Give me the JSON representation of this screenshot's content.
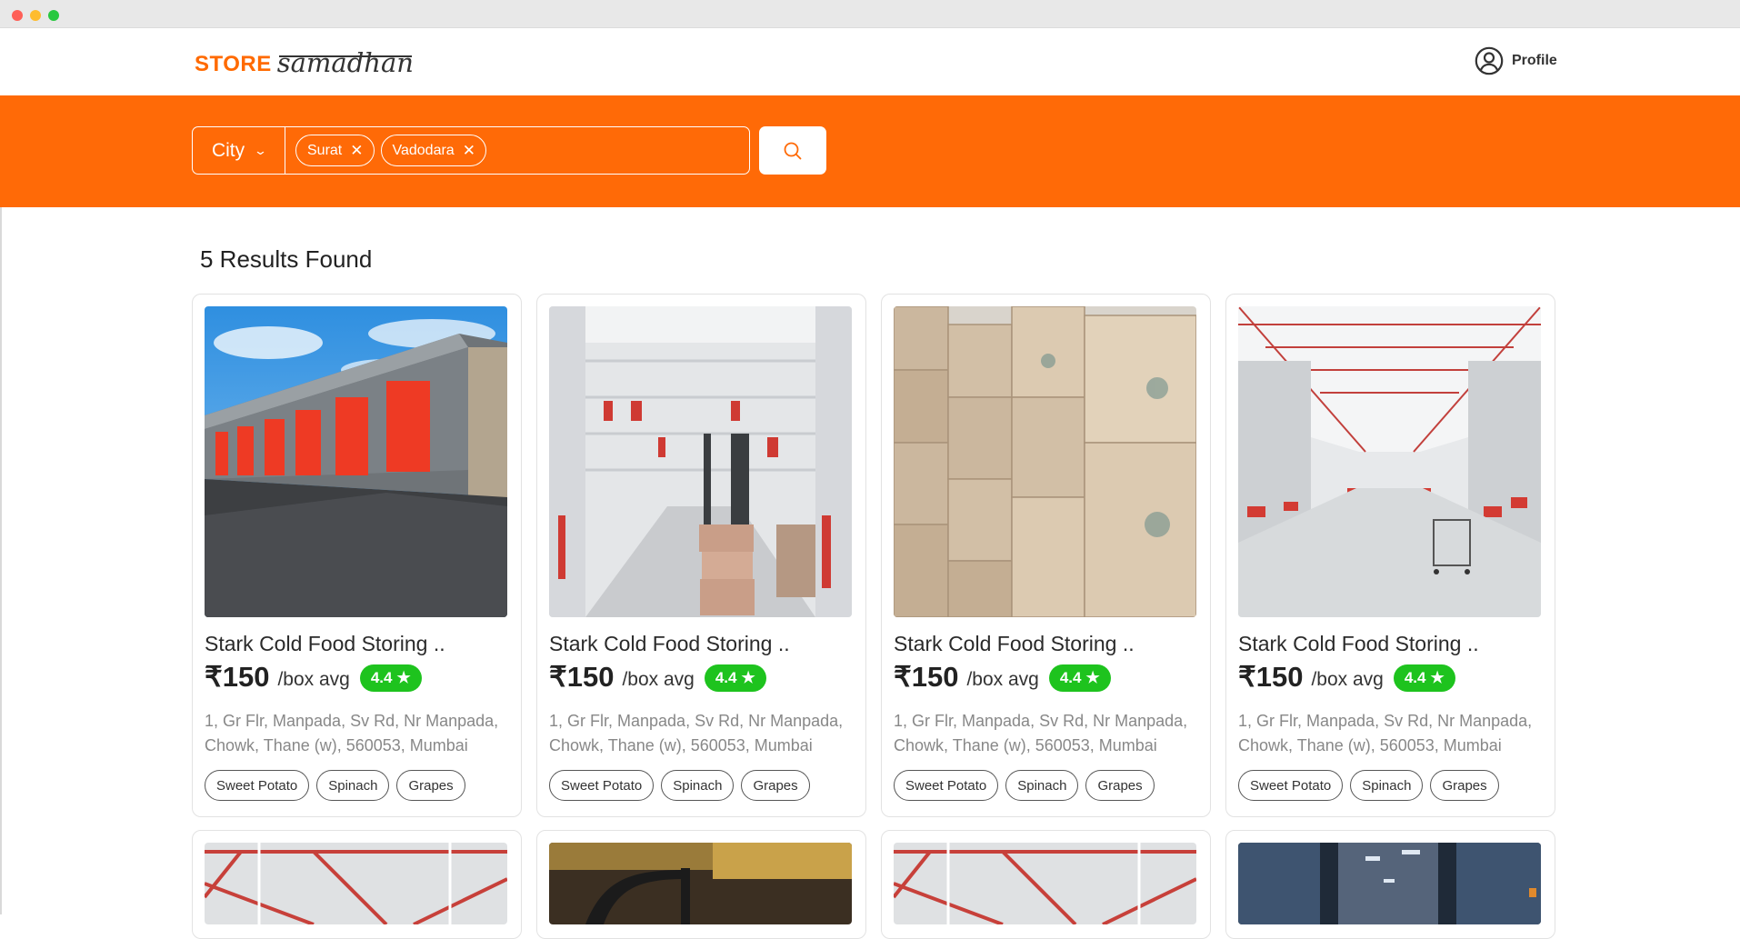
{
  "window": {
    "controls": [
      "close",
      "minimize",
      "maximize"
    ]
  },
  "header": {
    "logo_store": "STORE",
    "logo_samadhan": "samadhan",
    "profile_label": "Profile",
    "profile_icon": "user-circle-icon"
  },
  "search": {
    "city_label": "City",
    "chips": [
      "Surat",
      "Vadodara"
    ],
    "button_icon": "search-icon"
  },
  "results": {
    "title": "5 Results Found",
    "cards": [
      {
        "name": "Stark Cold Food Storing ..",
        "price": "₹150",
        "unit": "/box avg",
        "rating": "4.4",
        "address": "1, Gr Flr, Manpada, Sv Rd, Nr Manpada, Chowk, Thane (w),  560053, Mumbai",
        "tags": [
          "Sweet Potato",
          "Spinach",
          "Grapes"
        ]
      },
      {
        "name": "Stark Cold Food Storing ..",
        "price": "₹150",
        "unit": "/box avg",
        "rating": "4.4",
        "address": "1, Gr Flr, Manpada, Sv Rd, Nr Manpada, Chowk, Thane (w),  560053, Mumbai",
        "tags": [
          "Sweet Potato",
          "Spinach",
          "Grapes"
        ]
      },
      {
        "name": "Stark Cold Food Storing ..",
        "price": "₹150",
        "unit": "/box avg",
        "rating": "4.4",
        "address": "1, Gr Flr, Manpada, Sv Rd, Nr Manpada, Chowk, Thane (w),  560053, Mumbai",
        "tags": [
          "Sweet Potato",
          "Spinach",
          "Grapes"
        ]
      },
      {
        "name": "Stark Cold Food Storing ..",
        "price": "₹150",
        "unit": "/box avg",
        "rating": "4.4",
        "address": "1, Gr Flr, Manpada, Sv Rd, Nr Manpada, Chowk, Thane (w),  560053, Mumbai",
        "tags": [
          "Sweet Potato",
          "Spinach",
          "Grapes"
        ]
      }
    ]
  },
  "colors": {
    "brand_orange": "#ff6a07",
    "rating_green": "#1ec31e"
  }
}
